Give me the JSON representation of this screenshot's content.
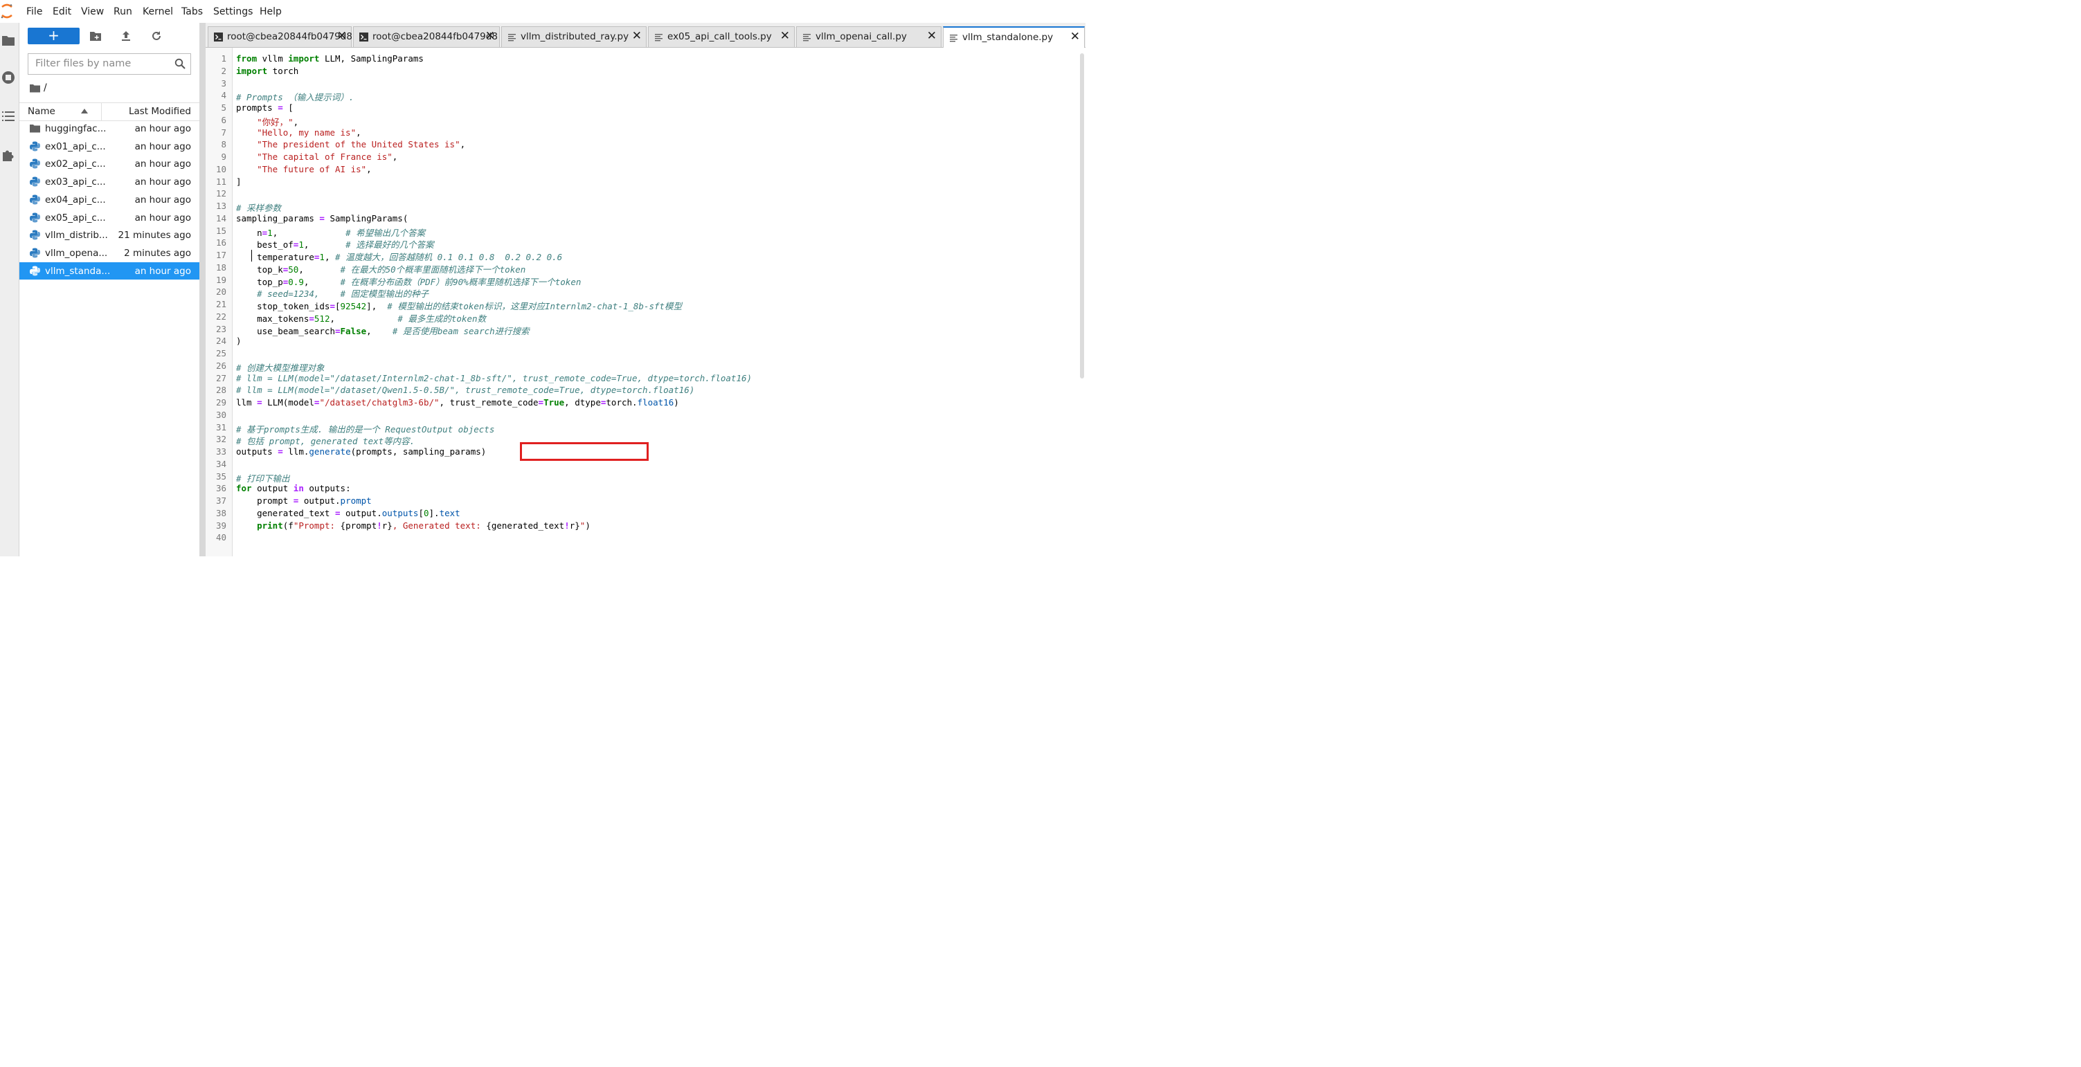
{
  "menubar": {
    "items": [
      "File",
      "Edit",
      "View",
      "Run",
      "Kernel",
      "Tabs",
      "Settings",
      "Help"
    ]
  },
  "filebrowser": {
    "new_label": "+",
    "search_placeholder": "Filter files by name",
    "path": "/",
    "columns": {
      "name": "Name",
      "modified": "Last Modified"
    },
    "files": [
      {
        "name": "huggingfac...",
        "modified": "an hour ago",
        "type": "folder"
      },
      {
        "name": "ex01_api_c...",
        "modified": "an hour ago",
        "type": "python"
      },
      {
        "name": "ex02_api_c...",
        "modified": "an hour ago",
        "type": "python"
      },
      {
        "name": "ex03_api_c...",
        "modified": "an hour ago",
        "type": "python"
      },
      {
        "name": "ex04_api_c...",
        "modified": "an hour ago",
        "type": "python"
      },
      {
        "name": "ex05_api_c...",
        "modified": "an hour ago",
        "type": "python"
      },
      {
        "name": "vllm_distrib...",
        "modified": "21 minutes ago",
        "type": "python"
      },
      {
        "name": "vllm_opena...",
        "modified": "2 minutes ago",
        "type": "python"
      },
      {
        "name": "vllm_standa...",
        "modified": "an hour ago",
        "type": "python",
        "selected": true
      }
    ]
  },
  "tabs": [
    {
      "label": "root@cbea20844fb0479d8",
      "type": "terminal"
    },
    {
      "label": "root@cbea20844fb0479d8",
      "type": "terminal"
    },
    {
      "label": "vllm_distributed_ray.py",
      "type": "file"
    },
    {
      "label": "ex05_api_call_tools.py",
      "type": "file"
    },
    {
      "label": "vllm_openai_call.py",
      "type": "file"
    },
    {
      "label": "vllm_standalone.py",
      "type": "file",
      "active": true
    }
  ],
  "editor": {
    "line_numbers": [
      "1",
      "2",
      "3",
      "4",
      "5",
      "6",
      "7",
      "8",
      "9",
      "10",
      "11",
      "12",
      "13",
      "14",
      "15",
      "16",
      "17",
      "18",
      "19",
      "20",
      "21",
      "22",
      "23",
      "24",
      "25",
      "26",
      "27",
      "28",
      "29",
      "30",
      "31",
      "32",
      "33",
      "34",
      "35",
      "36",
      "37",
      "38",
      "39",
      "40"
    ],
    "lines": [
      [
        {
          "t": "from",
          "c": "kw"
        },
        {
          "t": " vllm "
        },
        {
          "t": "import",
          "c": "kw"
        },
        {
          "t": " LLM, SamplingParams"
        }
      ],
      [
        {
          "t": "import",
          "c": "kw"
        },
        {
          "t": " torch"
        }
      ],
      [],
      [
        {
          "t": "# Prompts （输入提示词）.",
          "c": "com"
        }
      ],
      [
        {
          "t": "prompts "
        },
        {
          "t": "=",
          "c": "op"
        },
        {
          "t": " ["
        }
      ],
      [
        {
          "t": "    "
        },
        {
          "t": "\"你好，\"",
          "c": "str"
        },
        {
          "t": ","
        }
      ],
      [
        {
          "t": "    "
        },
        {
          "t": "\"Hello, my name is\"",
          "c": "str"
        },
        {
          "t": ","
        }
      ],
      [
        {
          "t": "    "
        },
        {
          "t": "\"The president of the United States is\"",
          "c": "str"
        },
        {
          "t": ","
        }
      ],
      [
        {
          "t": "    "
        },
        {
          "t": "\"The capital of France is\"",
          "c": "str"
        },
        {
          "t": ","
        }
      ],
      [
        {
          "t": "    "
        },
        {
          "t": "\"The future of AI is\"",
          "c": "str"
        },
        {
          "t": ","
        }
      ],
      [
        {
          "t": "]"
        }
      ],
      [],
      [
        {
          "t": "# 采样参数",
          "c": "com"
        }
      ],
      [
        {
          "t": "sampling_params "
        },
        {
          "t": "=",
          "c": "op"
        },
        {
          "t": " SamplingParams("
        }
      ],
      [
        {
          "t": "    n"
        },
        {
          "t": "=",
          "c": "op"
        },
        {
          "t": "1",
          "c": "num"
        },
        {
          "t": ",             "
        },
        {
          "t": "# 希望输出几个答案",
          "c": "com"
        }
      ],
      [
        {
          "t": "    best_of"
        },
        {
          "t": "=",
          "c": "op"
        },
        {
          "t": "1",
          "c": "num"
        },
        {
          "t": ",       "
        },
        {
          "t": "# 选择最好的几个答案",
          "c": "com"
        }
      ],
      [
        {
          "t": "    temperature"
        },
        {
          "t": "=",
          "c": "op"
        },
        {
          "t": "1",
          "c": "num"
        },
        {
          "t": ", "
        },
        {
          "t": "# 温度越大，回答越随机 0.1 0.1 0.8  0.2 0.2 0.6",
          "c": "com"
        }
      ],
      [
        {
          "t": "    top_k"
        },
        {
          "t": "=",
          "c": "op"
        },
        {
          "t": "50",
          "c": "num"
        },
        {
          "t": ",       "
        },
        {
          "t": "# 在最大的50个概率里面随机选择下一个token",
          "c": "com"
        }
      ],
      [
        {
          "t": "    top_p"
        },
        {
          "t": "=",
          "c": "op"
        },
        {
          "t": "0.9",
          "c": "num"
        },
        {
          "t": ",      "
        },
        {
          "t": "# 在概率分布函数（PDF）前90%概率里随机选择下一个token",
          "c": "com"
        }
      ],
      [
        {
          "t": "    "
        },
        {
          "t": "# seed=1234,    # 固定模型输出的种子",
          "c": "com"
        }
      ],
      [
        {
          "t": "    stop_token_ids"
        },
        {
          "t": "=",
          "c": "op"
        },
        {
          "t": "["
        },
        {
          "t": "92542",
          "c": "num"
        },
        {
          "t": "],  "
        },
        {
          "t": "# 模型输出的结束token标识，这里对应Internlm2-chat-1_8b-sft模型",
          "c": "com"
        }
      ],
      [
        {
          "t": "    max_tokens"
        },
        {
          "t": "=",
          "c": "op"
        },
        {
          "t": "512",
          "c": "num"
        },
        {
          "t": ",            "
        },
        {
          "t": "# 最多生成的token数",
          "c": "com"
        }
      ],
      [
        {
          "t": "    use_beam_search"
        },
        {
          "t": "=",
          "c": "op"
        },
        {
          "t": "False",
          "c": "kw"
        },
        {
          "t": ",    "
        },
        {
          "t": "# 是否使用beam search进行搜索",
          "c": "com"
        }
      ],
      [
        {
          "t": ")"
        }
      ],
      [],
      [
        {
          "t": "# 创建大模型推理对象",
          "c": "com"
        }
      ],
      [
        {
          "t": "# llm = LLM(model=\"/dataset/Internlm2-chat-1_8b-sft/\", trust_remote_code=True, dtype=torch.float16)",
          "c": "com"
        }
      ],
      [
        {
          "t": "# llm = LLM(model=\"/dataset/Qwen1.5-0.5B/\", trust_remote_code=True, dtype=torch.float16)",
          "c": "com"
        }
      ],
      [
        {
          "t": "llm "
        },
        {
          "t": "=",
          "c": "op"
        },
        {
          "t": " LLM(model"
        },
        {
          "t": "=",
          "c": "op"
        },
        {
          "t": "\"/dataset/chatglm3-6b/\"",
          "c": "str"
        },
        {
          "t": ", trust_remote_code"
        },
        {
          "t": "=",
          "c": "op"
        },
        {
          "t": "True",
          "c": "kw"
        },
        {
          "t": ", dtype"
        },
        {
          "t": "=",
          "c": "op"
        },
        {
          "t": "torch."
        },
        {
          "t": "float16",
          "c": "prop"
        },
        {
          "t": ")"
        }
      ],
      [],
      [
        {
          "t": "# 基于prompts生成. 输出的是一个 RequestOutput objects",
          "c": "com"
        }
      ],
      [
        {
          "t": "# 包括 prompt, generated text等内容.",
          "c": "com"
        }
      ],
      [
        {
          "t": "outputs "
        },
        {
          "t": "=",
          "c": "op"
        },
        {
          "t": " llm."
        },
        {
          "t": "generate",
          "c": "prop"
        },
        {
          "t": "(prompts, sampling_params)"
        }
      ],
      [],
      [
        {
          "t": "# 打印下输出",
          "c": "com"
        }
      ],
      [
        {
          "t": "for",
          "c": "kw"
        },
        {
          "t": " output "
        },
        {
          "t": "in",
          "c": "op"
        },
        {
          "t": " outputs:"
        }
      ],
      [
        {
          "t": "    prompt "
        },
        {
          "t": "=",
          "c": "op"
        },
        {
          "t": " output."
        },
        {
          "t": "prompt",
          "c": "prop"
        }
      ],
      [
        {
          "t": "    generated_text "
        },
        {
          "t": "=",
          "c": "op"
        },
        {
          "t": " output."
        },
        {
          "t": "outputs",
          "c": "prop"
        },
        {
          "t": "["
        },
        {
          "t": "0",
          "c": "num"
        },
        {
          "t": "]."
        },
        {
          "t": "text",
          "c": "prop"
        }
      ],
      [
        {
          "t": "    "
        },
        {
          "t": "print",
          "c": "kw"
        },
        {
          "t": "(f"
        },
        {
          "t": "\"Prompt: ",
          "c": "str"
        },
        {
          "t": "{prompt"
        },
        {
          "t": "!",
          "c": "op"
        },
        {
          "t": "r}"
        },
        {
          "t": ", Generated text: ",
          "c": "str"
        },
        {
          "t": "{generated_text"
        },
        {
          "t": "!",
          "c": "op"
        },
        {
          "t": "r}"
        },
        {
          "t": "\"",
          "c": "str"
        },
        {
          "t": ")"
        }
      ],
      []
    ]
  }
}
